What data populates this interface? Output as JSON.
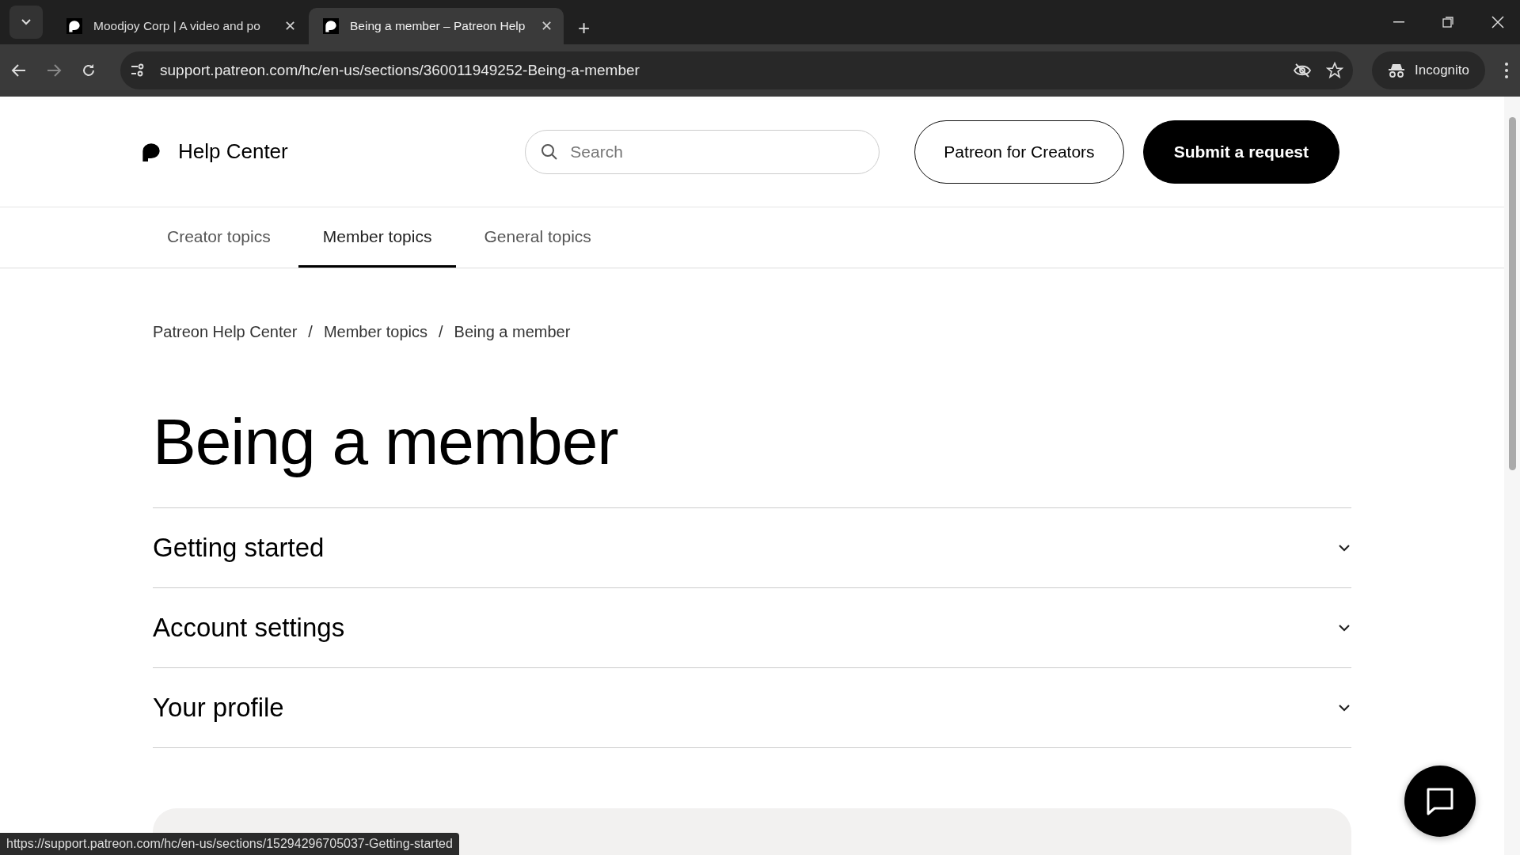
{
  "browser": {
    "tabs": [
      {
        "title": "Moodjoy Corp | A video and po",
        "selected": false
      },
      {
        "title": "Being a member – Patreon Help",
        "selected": true
      }
    ],
    "close_tab_glyph": "✕",
    "new_tab_glyph": "+",
    "url": "support.patreon.com/hc/en-us/sections/360011949252-Being-a-member",
    "profile": "Incognito"
  },
  "header": {
    "title": "Help Center",
    "search": {
      "placeholder": "Search"
    },
    "buttons": [
      {
        "label": "Patreon for Creators",
        "kind": "outline"
      },
      {
        "label": "Submit a request",
        "kind": "filled"
      }
    ]
  },
  "nav": [
    {
      "label": "Creator topics",
      "selected": false
    },
    {
      "label": "Member topics",
      "selected": true
    },
    {
      "label": "General topics",
      "selected": false
    }
  ],
  "breadcrumbs": [
    "Patreon Help Center",
    "Member topics",
    "Being a member"
  ],
  "breadcrumb_separator": "/",
  "page_title": "Being a member",
  "sections": [
    {
      "title": "Getting started",
      "expanded": false
    },
    {
      "title": "Account settings",
      "expanded": false
    },
    {
      "title": "Your profile",
      "expanded": false
    }
  ],
  "status_url": "https://support.patreon.com/hc/en-us/sections/15294296705037-Getting-started"
}
